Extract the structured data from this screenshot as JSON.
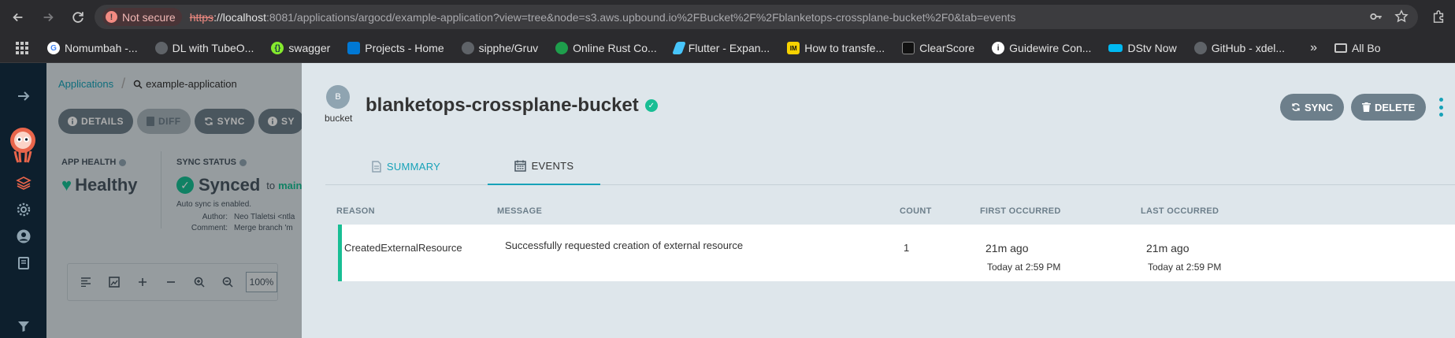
{
  "browser": {
    "security_label": "Not secure",
    "url_scheme": "https",
    "url_host": "://localhost",
    "url_path": ":8081/applications/argocd/example-application?view=tree&node=s3.aws.upbound.io%2FBucket%2F%2Fblanketops-crossplane-bucket%2F0&tab=events",
    "bookmarks": [
      {
        "label": "Nomumbah -...",
        "icon": "google-icon",
        "color": "#ffffff"
      },
      {
        "label": "DL with TubeO...",
        "icon": "globe-icon",
        "color": "#5f6368"
      },
      {
        "label": "swagger",
        "icon": "swagger-icon",
        "color": "#85ea2d"
      },
      {
        "label": "Projects - Home",
        "icon": "azure-devops-icon",
        "color": "#0078d4"
      },
      {
        "label": "sipphe/Gruv",
        "icon": "github-icon",
        "color": "#5f6368"
      },
      {
        "label": "Online Rust Co...",
        "icon": "rust-playground-icon",
        "color": "#1e9e4c"
      },
      {
        "label": "Flutter - Expan...",
        "icon": "flutter-icon",
        "color": "#47c5fb"
      },
      {
        "label": "How to transfe...",
        "icon": "im-icon",
        "color": "#f7d200"
      },
      {
        "label": "ClearScore",
        "icon": "clearscore-icon",
        "color": "#111111"
      },
      {
        "label": "Guidewire Con...",
        "icon": "info-icon",
        "color": "#ffffff"
      },
      {
        "label": "DStv Now",
        "icon": "dstv-icon",
        "color": "#00b9f2"
      },
      {
        "label": "GitHub - xdel...",
        "icon": "github-icon",
        "color": "#5f6368"
      }
    ],
    "more_label": "»",
    "all_bookmarks_label": "All Bo"
  },
  "app": {
    "breadcrumb": {
      "root": "Applications",
      "current": "example-application"
    },
    "toolbar": [
      "DETAILS",
      "DIFF",
      "SYNC",
      "SY"
    ],
    "health_label": "APP HEALTH",
    "health_value": "Healthy",
    "sync_label": "SYNC STATUS",
    "sync_value": "Synced",
    "sync_to": "to",
    "sync_branch": "main",
    "auto_sync": "Auto sync is enabled.",
    "author_key": "Author:",
    "author_val": "Neo Tlaletsi <ntla",
    "comment_key": "Comment:",
    "comment_val": "Merge branch 'm",
    "zoom_pct": "100%"
  },
  "panel": {
    "avatar_letter": "B",
    "kind": "bucket",
    "title": "blanketops-crossplane-bucket",
    "sync_button": "SYNC",
    "delete_button": "DELETE",
    "tabs": {
      "summary": "SUMMARY",
      "events": "EVENTS"
    },
    "events": {
      "columns": {
        "reason": "REASON",
        "message": "MESSAGE",
        "count": "COUNT",
        "first": "FIRST OCCURRED",
        "last": "LAST OCCURRED"
      },
      "rows": [
        {
          "reason": "CreatedExternalResource",
          "message": "Successfully requested creation of external resource",
          "count": "1",
          "first_rel": "21m ago",
          "first_abs": "Today at 2:59 PM",
          "last_rel": "21m ago",
          "last_abs": "Today at 2:59 PM"
        }
      ]
    }
  },
  "colors": {
    "accent": "#17a2b8",
    "healthy": "#18be94",
    "button": "#6d7f8b"
  }
}
